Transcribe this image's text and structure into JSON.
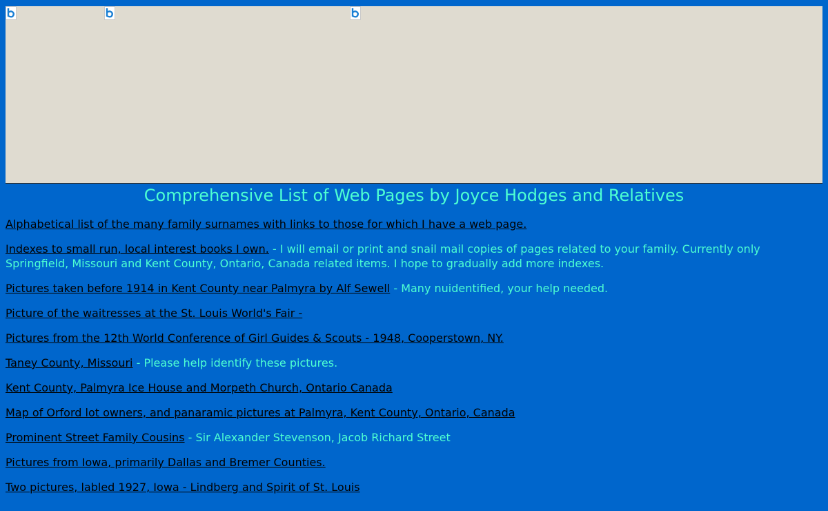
{
  "page": {
    "title": "Comprehensive List of Web Pages by Joyce Hodges and Relatives"
  },
  "banner": {
    "images": [
      {
        "icon": "broken-image-icon"
      },
      {
        "icon": "broken-image-icon"
      },
      {
        "icon": "broken-image-icon"
      }
    ]
  },
  "entries": [
    {
      "link": "Alphabetical list of the many family surnames with links to those for which I have a web page.",
      "note": ""
    },
    {
      "link": "Indexes to small run, local interest books I own.",
      "note": " - I will email or print and snail mail copies of pages related to your family. Currently only Springfield, Missouri and Kent County, Ontario, Canada related items. I hope to gradually add more indexes."
    },
    {
      "link": "Pictures taken before 1914 in Kent County near Palmyra by Alf Sewell",
      "note": " - Many nuidentified, your help needed."
    },
    {
      "link": "Picture of the waitresses at the St. Louis World's Fair -",
      "note": ""
    },
    {
      "link": "Pictures from the 12th World Conference of Girl Guides & Scouts - 1948, Cooperstown, NY.",
      "note": ""
    },
    {
      "link": "Taney County, Missouri",
      "note": " - Please help identify these pictures."
    },
    {
      "link": "Kent County, Palmyra Ice House and Morpeth Church, Ontario Canada",
      "note": ""
    },
    {
      "link": "Map of Orford lot owners, and panaramic pictures at Palmyra, Kent County, Ontario, Canada",
      "note": ""
    },
    {
      "link": "Prominent Street Family Cousins",
      "note": " - Sir Alexander Stevenson, Jacob Richard Street"
    },
    {
      "link": "Pictures from Iowa, primarily Dallas and Bremer Counties.",
      "note": ""
    },
    {
      "link": "Two pictures, labled 1927, Iowa - Lindberg and Spirit of St. Louis",
      "note": ""
    }
  ]
}
